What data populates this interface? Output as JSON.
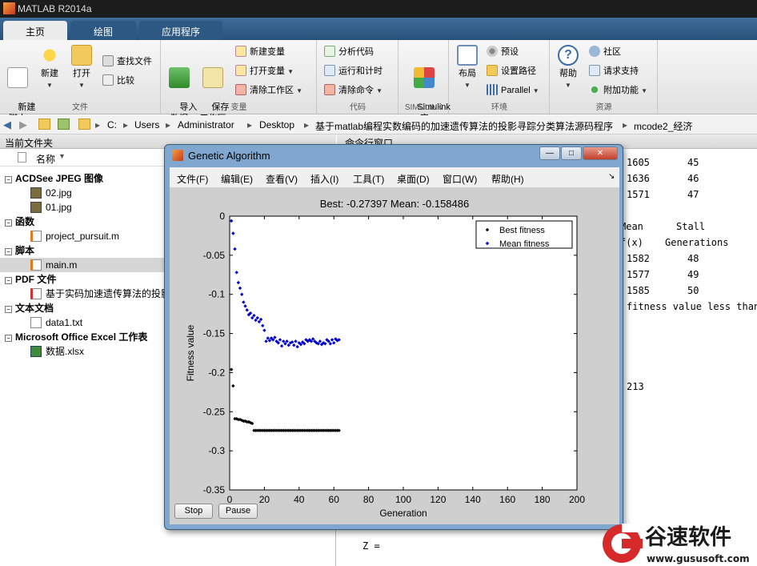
{
  "app": {
    "title": "MATLAB R2014a"
  },
  "tabs": [
    {
      "label": "主页"
    },
    {
      "label": "绘图"
    },
    {
      "label": "应用程序"
    }
  ],
  "ribbon": {
    "file": {
      "label": "文件",
      "new_script": "新建\n脚本",
      "new": "新建",
      "open": "打开",
      "find_files": "查找文件",
      "compare": "比较"
    },
    "variable": {
      "label": "变量",
      "import_data": "导入\n数据",
      "save_workspace": "保存\n工作区",
      "new_variable": "新建变量",
      "open_variable": "打开变量",
      "clear_workspace": "清除工作区"
    },
    "code": {
      "label": "代码",
      "analyze": "分析代码",
      "run_time": "运行和计时",
      "clear_cmds": "清除命令"
    },
    "simulink": {
      "label": "SIMULINK",
      "lib": "Simulink\n库"
    },
    "env": {
      "label": "环境",
      "layout": "布局",
      "prefs": "预设",
      "set_path": "设置路径",
      "parallel": "Parallel"
    },
    "resources": {
      "label": "资源",
      "help": "帮助",
      "community": "社区",
      "support": "请求支持",
      "addons": "附加功能"
    }
  },
  "address": {
    "crumbs": [
      "C:",
      "Users",
      "Administrator",
      "Desktop",
      "基于matlab编程实数编码的加速遗传算法的投影寻踪分类算法源码程序",
      "mcode2_经济"
    ]
  },
  "files": {
    "panel_title": "当前文件夹",
    "col_name": "名称",
    "sections": [
      {
        "label": "ACDSee JPEG 图像",
        "items": [
          "02.jpg",
          "01.jpg"
        ]
      },
      {
        "label": "函数",
        "items": [
          "project_pursuit.m"
        ]
      },
      {
        "label": "脚本",
        "items": [
          "main.m"
        ]
      },
      {
        "label": "PDF 文件",
        "items": [
          "基于实码加速遗传算法的投影"
        ]
      },
      {
        "label": "文本文档",
        "items": [
          "data1.txt"
        ]
      },
      {
        "label": "Microsoft Office Excel 工作表",
        "items": [
          "数据.xlsx"
        ]
      }
    ]
  },
  "command": {
    "panel_title": "命令行窗口",
    "rows": [
      {
        "a": "1605",
        "b": "45"
      },
      {
        "a": "1636",
        "b": "46"
      },
      {
        "a": "1571",
        "b": "47"
      }
    ],
    "hdr1": {
      "a": "Mean",
      "b": "Stall"
    },
    "hdr2": {
      "a": "f(x)",
      "b": "Generations"
    },
    "rows2": [
      {
        "a": "1582",
        "b": "48"
      },
      {
        "a": "1577",
        "b": "49"
      },
      {
        "a": "1585",
        "b": "50"
      }
    ],
    "msg": "fitness value less than",
    "val": "213",
    "z": "Z ="
  },
  "figure": {
    "title": "Genetic Algorithm",
    "menus": [
      "文件(F)",
      "编辑(E)",
      "查看(V)",
      "插入(I)",
      "工具(T)",
      "桌面(D)",
      "窗口(W)",
      "帮助(H)"
    ],
    "stop": "Stop",
    "pause": "Pause"
  },
  "chart_data": {
    "type": "scatter",
    "title": "Best: -0.27397 Mean: -0.158486",
    "xlabel": "Generation",
    "ylabel": "Fitness value",
    "xlim": [
      0,
      200
    ],
    "ylim": [
      -0.35,
      0
    ],
    "xticks": [
      0,
      20,
      40,
      60,
      80,
      100,
      120,
      140,
      160,
      180,
      200
    ],
    "yticks": [
      0,
      -0.05,
      -0.1,
      -0.15,
      -0.2,
      -0.25,
      -0.3,
      -0.35
    ],
    "legend": "top-right",
    "series": [
      {
        "name": "Best fitness",
        "color": "#000000",
        "x": [
          1,
          2,
          3,
          4,
          5,
          6,
          7,
          8,
          9,
          10,
          11,
          12,
          13,
          14,
          15,
          16,
          17,
          18,
          19,
          20,
          21,
          22,
          23,
          24,
          25,
          26,
          27,
          28,
          29,
          30,
          31,
          32,
          33,
          34,
          35,
          36,
          37,
          38,
          39,
          40,
          41,
          42,
          43,
          44,
          45,
          46,
          47,
          48,
          49,
          50,
          51,
          52,
          53,
          54,
          55,
          56,
          57,
          58,
          59,
          60,
          61,
          62,
          63
        ],
        "y": [
          -0.196,
          -0.217,
          -0.259,
          -0.259,
          -0.26,
          -0.26,
          -0.261,
          -0.262,
          -0.262,
          -0.263,
          -0.263,
          -0.264,
          -0.265,
          -0.274,
          -0.274,
          -0.274,
          -0.274,
          -0.274,
          -0.274,
          -0.274,
          -0.274,
          -0.274,
          -0.274,
          -0.274,
          -0.274,
          -0.274,
          -0.274,
          -0.274,
          -0.274,
          -0.274,
          -0.274,
          -0.274,
          -0.274,
          -0.274,
          -0.274,
          -0.274,
          -0.274,
          -0.274,
          -0.274,
          -0.274,
          -0.274,
          -0.274,
          -0.274,
          -0.274,
          -0.274,
          -0.274,
          -0.274,
          -0.274,
          -0.274,
          -0.274,
          -0.274,
          -0.274,
          -0.274,
          -0.274,
          -0.274,
          -0.274,
          -0.274,
          -0.274,
          -0.274,
          -0.274,
          -0.274,
          -0.274,
          -0.274
        ]
      },
      {
        "name": "Mean fitness",
        "color": "#0000cc",
        "x": [
          1,
          2,
          3,
          4,
          5,
          6,
          7,
          8,
          9,
          10,
          11,
          12,
          13,
          14,
          15,
          16,
          17,
          18,
          19,
          20,
          21,
          22,
          23,
          24,
          25,
          26,
          27,
          28,
          29,
          30,
          31,
          32,
          33,
          34,
          35,
          36,
          37,
          38,
          39,
          40,
          41,
          42,
          43,
          44,
          45,
          46,
          47,
          48,
          49,
          50,
          51,
          52,
          53,
          54,
          55,
          56,
          57,
          58,
          59,
          60,
          61,
          62,
          63
        ],
        "y": [
          -0.006,
          -0.022,
          -0.042,
          -0.072,
          -0.085,
          -0.092,
          -0.1,
          -0.11,
          -0.115,
          -0.12,
          -0.126,
          -0.124,
          -0.13,
          -0.127,
          -0.133,
          -0.13,
          -0.135,
          -0.132,
          -0.14,
          -0.146,
          -0.16,
          -0.156,
          -0.159,
          -0.156,
          -0.158,
          -0.155,
          -0.16,
          -0.162,
          -0.158,
          -0.166,
          -0.16,
          -0.163,
          -0.16,
          -0.165,
          -0.162,
          -0.161,
          -0.165,
          -0.16,
          -0.167,
          -0.162,
          -0.164,
          -0.161,
          -0.163,
          -0.158,
          -0.16,
          -0.158,
          -0.16,
          -0.157,
          -0.16,
          -0.162,
          -0.163,
          -0.16,
          -0.164,
          -0.162,
          -0.163,
          -0.158,
          -0.16,
          -0.163,
          -0.158,
          -0.162,
          -0.157,
          -0.159,
          -0.158
        ]
      }
    ]
  }
}
